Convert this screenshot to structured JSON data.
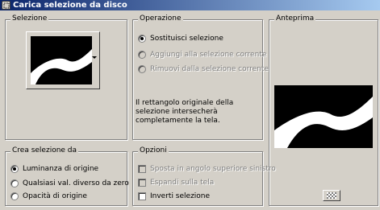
{
  "window": {
    "title": "Carica selezione da disco"
  },
  "selezione": {
    "label": "Selezione"
  },
  "operazione": {
    "label": "Operazione",
    "options": [
      {
        "label": "Sostituisci selezione",
        "selected": true,
        "enabled": true
      },
      {
        "label": "Aggiungi alla selezione corrente",
        "selected": false,
        "enabled": false
      },
      {
        "label": "Rimuovi dalla selezione corrente",
        "selected": false,
        "enabled": false
      }
    ],
    "info": "Il rettangolo originale della selezione intersecherà completamente la tela."
  },
  "anteprima": {
    "label": "Anteprima"
  },
  "crea": {
    "label": "Crea selezione da",
    "options": [
      {
        "label": "Luminanza di origine",
        "selected": true
      },
      {
        "label": "Qualsiasi val. diverso da zero",
        "selected": false
      },
      {
        "label": "Opacità di origine",
        "selected": false
      }
    ]
  },
  "opzioni": {
    "label": "Opzioni",
    "items": [
      {
        "label": "Sposta in angolo superiore sinistro",
        "checked": false,
        "enabled": false
      },
      {
        "label": "Espandi sulla tela",
        "checked": false,
        "enabled": false
      },
      {
        "label": "Inverti selezione",
        "checked": false,
        "enabled": true
      }
    ]
  },
  "colors": {
    "titlebar_start": "#0a246a",
    "titlebar_end": "#a6caf0",
    "face": "#d4d0c8"
  },
  "icons": {
    "title": "selection-disk-icon",
    "checker": "checkerboard-icon",
    "dropdown": "chevron-down-icon"
  }
}
